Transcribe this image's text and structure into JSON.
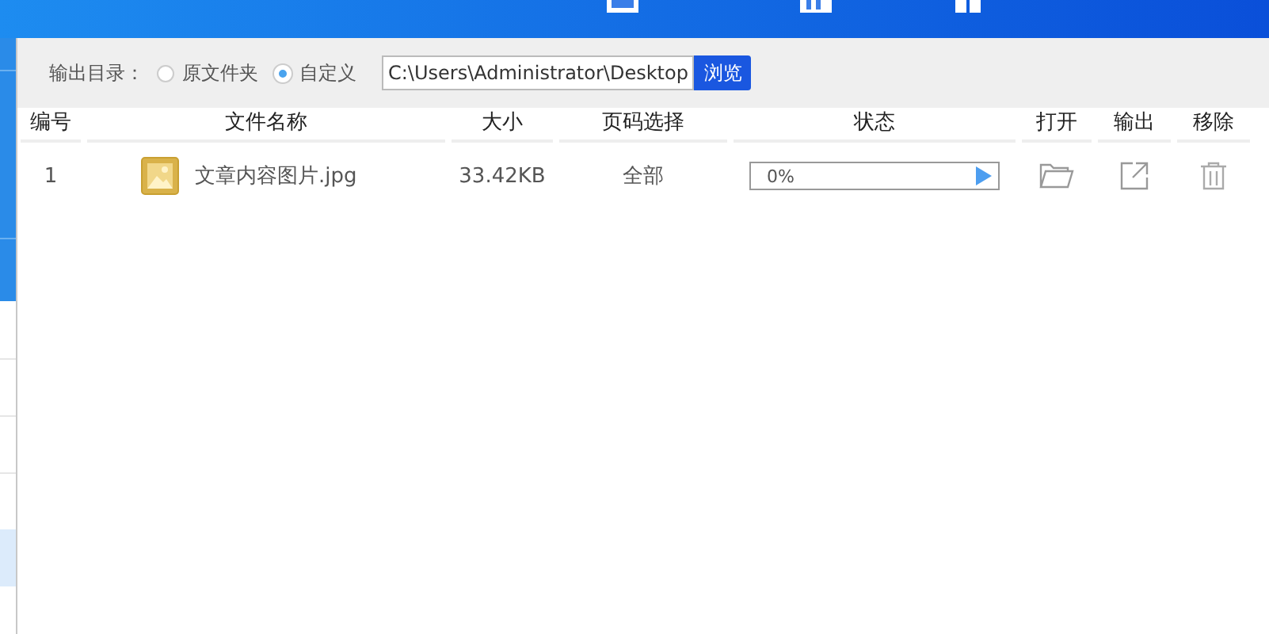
{
  "output_bar": {
    "label": "输出目录：",
    "options": [
      {
        "label": "原文件夹",
        "selected": false
      },
      {
        "label": "自定义",
        "selected": true
      }
    ],
    "path": "C:\\Users\\Administrator\\Desktop",
    "browse_button": "浏览"
  },
  "table": {
    "columns": [
      "编号",
      "文件名称",
      "大小",
      "页码选择",
      "状态",
      "打开",
      "输出",
      "移除"
    ],
    "rows": [
      {
        "index": "1",
        "name": "文章内容图片.jpg",
        "size": "33.42KB",
        "pages": "全部",
        "progress": "0%",
        "level": 0
      }
    ]
  }
}
